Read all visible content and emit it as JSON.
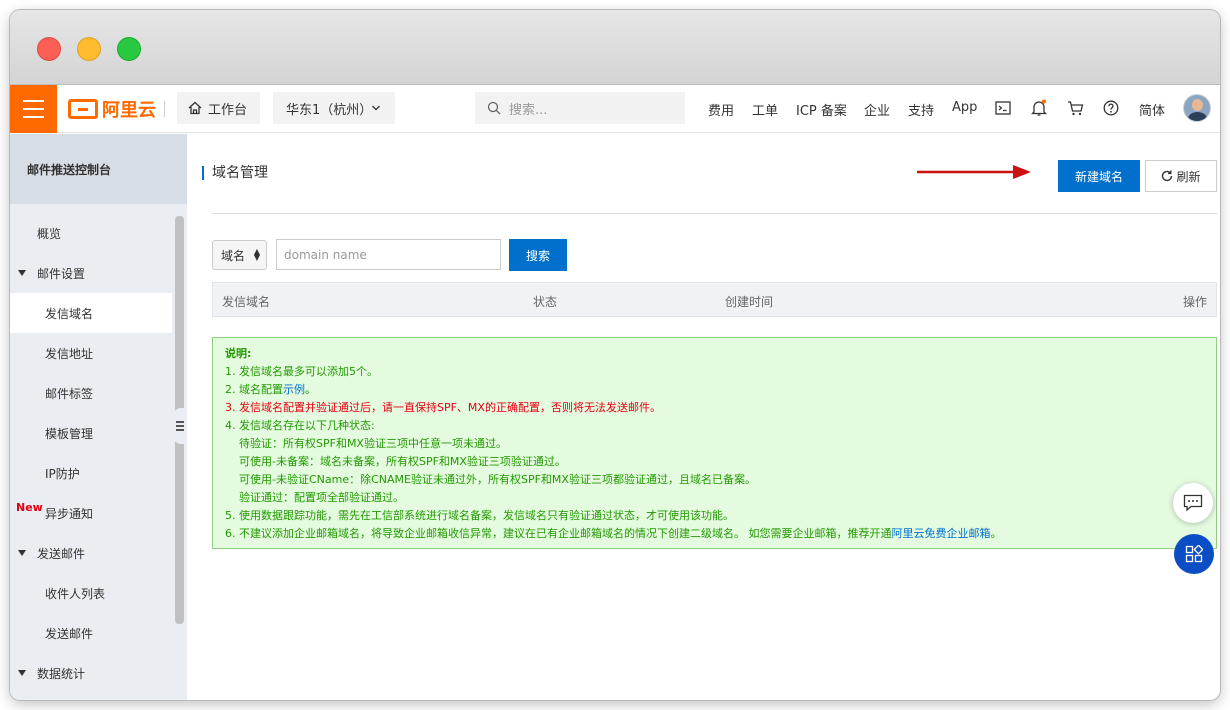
{
  "app": {
    "logo_text": "阿里云",
    "workbench_label": "工作台",
    "region_label": "华东1（杭州）",
    "search_placeholder": "搜索...",
    "nav_links": [
      "费用",
      "工单",
      "ICP 备案",
      "企业",
      "支持",
      "App"
    ],
    "lang_label": "简体",
    "brand_color": "#ff6a00",
    "accent_color": "#0070cc"
  },
  "sidebar": {
    "title": "邮件推送控制台",
    "items": [
      {
        "label": "概览",
        "type": "item"
      },
      {
        "label": "邮件设置",
        "type": "group"
      },
      {
        "label": "发信域名",
        "type": "subitem",
        "active": true
      },
      {
        "label": "发信地址",
        "type": "subitem"
      },
      {
        "label": "邮件标签",
        "type": "subitem"
      },
      {
        "label": "模板管理",
        "type": "subitem"
      },
      {
        "label": "IP防护",
        "type": "subitem"
      },
      {
        "label": "异步通知",
        "type": "subitem",
        "badge": "New"
      },
      {
        "label": "发送邮件",
        "type": "group"
      },
      {
        "label": "收件人列表",
        "type": "subitem"
      },
      {
        "label": "发送邮件",
        "type": "subitem"
      },
      {
        "label": "数据统计",
        "type": "group"
      }
    ]
  },
  "main": {
    "title": "域名管理",
    "new_domain_button": "新建域名",
    "refresh_button": "刷新",
    "filter_select": "域名",
    "domain_input_placeholder": "domain name",
    "search_button": "搜索",
    "table_headers": [
      "发信域名",
      "状态",
      "创建时间",
      "操作"
    ]
  },
  "notice": {
    "title": "说明:",
    "lines": {
      "l1": "1. 发信域名最多可以添加5个。",
      "l2_pre": "2. 域名配置",
      "l2_link": "示例",
      "l2_post": "。",
      "l3": "3. 发信域名配置并验证通过后，请一直保持SPF、MX的正确配置，否则将无法发送邮件。",
      "l4": "4. 发信域名存在以下几种状态:",
      "l4a": "待验证：所有权SPF和MX验证三项中任意一项未通过。",
      "l4b": "可使用-未备案：域名未备案，所有权SPF和MX验证三项验证通过。",
      "l4c": "可使用-未验证CName：除CNAME验证未通过外，所有权SPF和MX验证三项都验证通过，且域名已备案。",
      "l4d": "验证通过：配置项全部验证通过。",
      "l5": "5. 使用数据跟踪功能，需先在工信部系统进行域名备案，发信域名只有验证通过状态，才可使用该功能。",
      "l6_pre": "6. 不建议添加企业邮箱域名，将导致企业邮箱收信异常，建议在已有企业邮箱域名的情况下创建二级域名。 如您需要企业邮箱，推荐开通",
      "l6_link": "阿里云免费企业邮箱",
      "l6_post": "。"
    }
  }
}
